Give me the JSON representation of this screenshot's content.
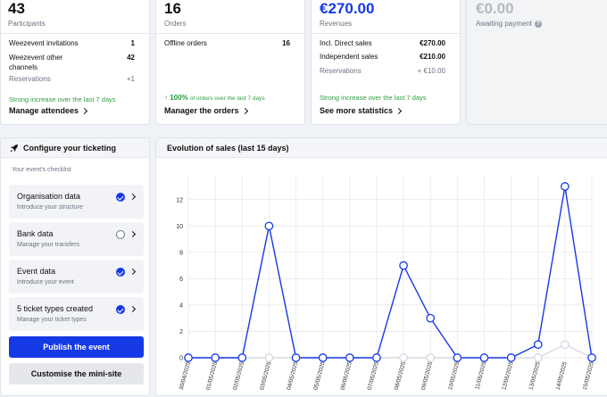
{
  "cards": [
    {
      "value": "43",
      "label": "Participants",
      "rows": [
        {
          "label": "Weezevent invitations",
          "value": "1"
        },
        {
          "label": "Weezevent other channels",
          "value": "42"
        },
        {
          "label": "Reservations",
          "value": "+1"
        }
      ],
      "trend": "Strong increase over the last 7 days",
      "link": "Manage attendees"
    },
    {
      "value": "16",
      "label": "Orders",
      "rows": [
        {
          "label": "Offline orders",
          "value": "16"
        }
      ],
      "trend_pct": "↑ 100%",
      "trend_text": "of orders over the last 7 days",
      "link": "Manager the orders"
    },
    {
      "value": "€270.00",
      "label": "Revenues",
      "rows": [
        {
          "label": "Incl. Direct sales",
          "value": "€270.00"
        },
        {
          "label": "Independent sales",
          "value": "€210.00"
        },
        {
          "label": "Reservations",
          "value": "+ €10.00"
        }
      ],
      "trend": "Strong increase over the last 7 days",
      "link": "See more statistics"
    },
    {
      "value": "€0.00",
      "label": "Awaiting payment",
      "help": "?"
    }
  ],
  "ticketing": {
    "title": "Configure your ticketing",
    "checklist_label": "Your event's checklist",
    "items": [
      {
        "title": "Organisation data",
        "subtitle": "Introduce your structure",
        "done": true
      },
      {
        "title": "Bank data",
        "subtitle": "Manage your transfers",
        "done": false
      },
      {
        "title": "Event data",
        "subtitle": "Introduce your event",
        "done": true
      },
      {
        "title": "5 ticket types created",
        "subtitle": "Manage your ticket types",
        "done": true
      }
    ],
    "publish_label": "Publish the event",
    "customise_label": "Customise the mini-site"
  },
  "sales_panel": {
    "title": "Evolution of sales (last 15 days)"
  },
  "chart_data": {
    "type": "line",
    "x": [
      "30/04/2025",
      "01/05/2025",
      "02/05/2025",
      "03/05/2025",
      "04/05/2025",
      "05/05/2025",
      "06/05/2025",
      "07/05/2025",
      "08/05/2025",
      "09/05/2025",
      "10/05/2025",
      "11/05/2025",
      "12/05/2025",
      "13/05/2025",
      "14/05/2025",
      "15/05/2025"
    ],
    "series": [
      {
        "color": "#1639e6",
        "values": [
          0,
          0,
          0,
          10,
          0,
          0,
          0,
          0,
          7,
          3,
          0,
          0,
          0,
          1,
          13,
          0
        ]
      },
      {
        "color": "#d4d9e2",
        "values": [
          0,
          0,
          0,
          0,
          0,
          0,
          0,
          0,
          0,
          0,
          0,
          0,
          0,
          0,
          1,
          0
        ]
      }
    ],
    "ylim": [
      0,
      13
    ],
    "yticks": [
      0,
      2,
      4,
      6,
      8,
      10,
      12
    ],
    "grid": true
  }
}
